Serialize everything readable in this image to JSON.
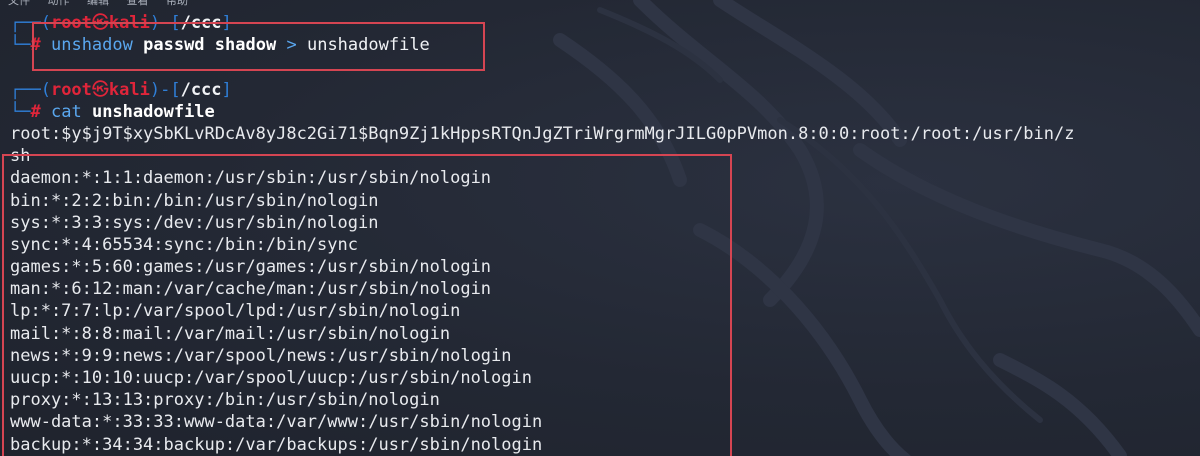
{
  "window": {
    "menu": [
      "文件",
      "动作",
      "编辑",
      "查看",
      "帮助"
    ]
  },
  "prompts": [
    {
      "user": "root",
      "skull": "㉿",
      "host": "kali",
      "path": "/ccc",
      "hash": "#",
      "command": "unshadow",
      "arg1": "passwd",
      "arg2": "shadow",
      "operator": ">",
      "arg3": "unshadowfile"
    },
    {
      "user": "root",
      "skull": "㉿",
      "host": "kali",
      "path": "/ccc",
      "hash": "#",
      "command": "cat",
      "arg1": "unshadowfile"
    }
  ],
  "output": [
    "root:$y$j9T$xySbKLvRDcAv8yJ8c2Gi71$Bqn9Zj1kHppsRTQnJgZTriWrgrmMgrJILG0pPVmon.8:0:0:root:/root:/usr/bin/z",
    "sh",
    "daemon:*:1:1:daemon:/usr/sbin:/usr/sbin/nologin",
    "bin:*:2:2:bin:/bin:/usr/sbin/nologin",
    "sys:*:3:3:sys:/dev:/usr/sbin/nologin",
    "sync:*:4:65534:sync:/bin:/bin/sync",
    "games:*:5:60:games:/usr/games:/usr/sbin/nologin",
    "man:*:6:12:man:/var/cache/man:/usr/sbin/nologin",
    "lp:*:7:7:lp:/var/spool/lpd:/usr/sbin/nologin",
    "mail:*:8:8:mail:/var/mail:/usr/sbin/nologin",
    "news:*:9:9:news:/var/spool/news:/usr/sbin/nologin",
    "uucp:*:10:10:uucp:/var/spool/uucp:/usr/sbin/nologin",
    "proxy:*:13:13:proxy:/bin:/usr/sbin/nologin",
    "www-data:*:33:33:www-data:/var/www:/usr/sbin/nologin",
    "backup:*:34:34:backup:/var/backups:/usr/sbin/nologin"
  ],
  "colors": {
    "background": "#252a36",
    "prompt_red": "#e0253a",
    "prompt_blue": "#2f7fd8",
    "command_blue": "#5aa7ef",
    "highlight_box": "#d54552"
  }
}
